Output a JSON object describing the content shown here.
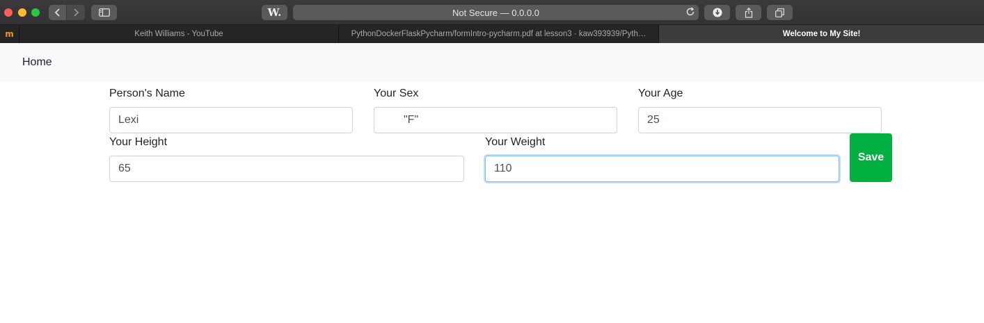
{
  "browser": {
    "address_text": "Not Secure — 0.0.0.0",
    "w_button_label": "W.",
    "pinned_tab_logo": "m",
    "tabs": [
      {
        "title": "Keith Williams - YouTube",
        "active": false
      },
      {
        "title": "PythonDockerFlaskPycharm/formIntro-pycharm.pdf at lesson3 · kaw393939/Pyth…",
        "active": false
      },
      {
        "title": "Welcome to My Site!",
        "active": true
      }
    ],
    "icons": [
      "back-icon",
      "forward-icon",
      "sidebar-icon",
      "reload-icon",
      "download-icon",
      "share-icon",
      "tabs-overview-icon"
    ]
  },
  "navbar": {
    "home_label": "Home"
  },
  "form": {
    "name": {
      "label": "Person's Name",
      "value": "Lexi"
    },
    "sex": {
      "label": "Your Sex",
      "value": "\"F\""
    },
    "age": {
      "label": "Your Age",
      "value": "25"
    },
    "height": {
      "label": "Your Height",
      "value": "65"
    },
    "weight": {
      "label": "Your Weight",
      "value": "110"
    },
    "save_label": "Save"
  },
  "colors": {
    "save_button": "#01b040",
    "navbar_bg": "#f8f9fa",
    "focus_border": "#80bdff"
  }
}
